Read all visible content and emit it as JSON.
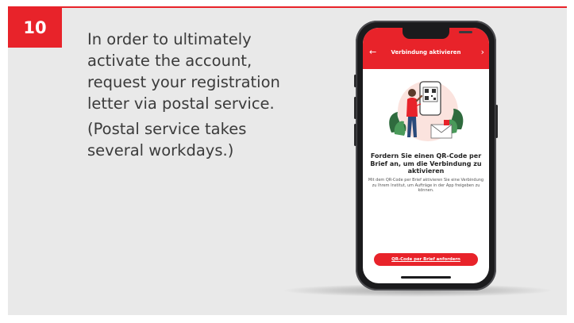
{
  "step": {
    "number": "10"
  },
  "instructions": {
    "main": "In order to ultimately activate the account, request your registration letter via postal service.",
    "note": "(Postal service takes several workdays.)"
  },
  "phone_screen": {
    "header": {
      "title": "Verbindung aktivieren",
      "back_icon": "←",
      "forward_icon": "›"
    },
    "heading": "Fordern Sie einen QR-Code per Brief an, um die Verbindung zu aktivieren",
    "body": "Mit dem QR-Code per Brief aktivieren Sie eine Verbindung zu Ihrem Institut, um Aufträge in der App freigeben zu können.",
    "cta_label": "QR-Code per Brief anfordern"
  },
  "colors": {
    "accent": "#e8232a",
    "panel": "#e9e9e9",
    "text": "#3b3b3b"
  }
}
